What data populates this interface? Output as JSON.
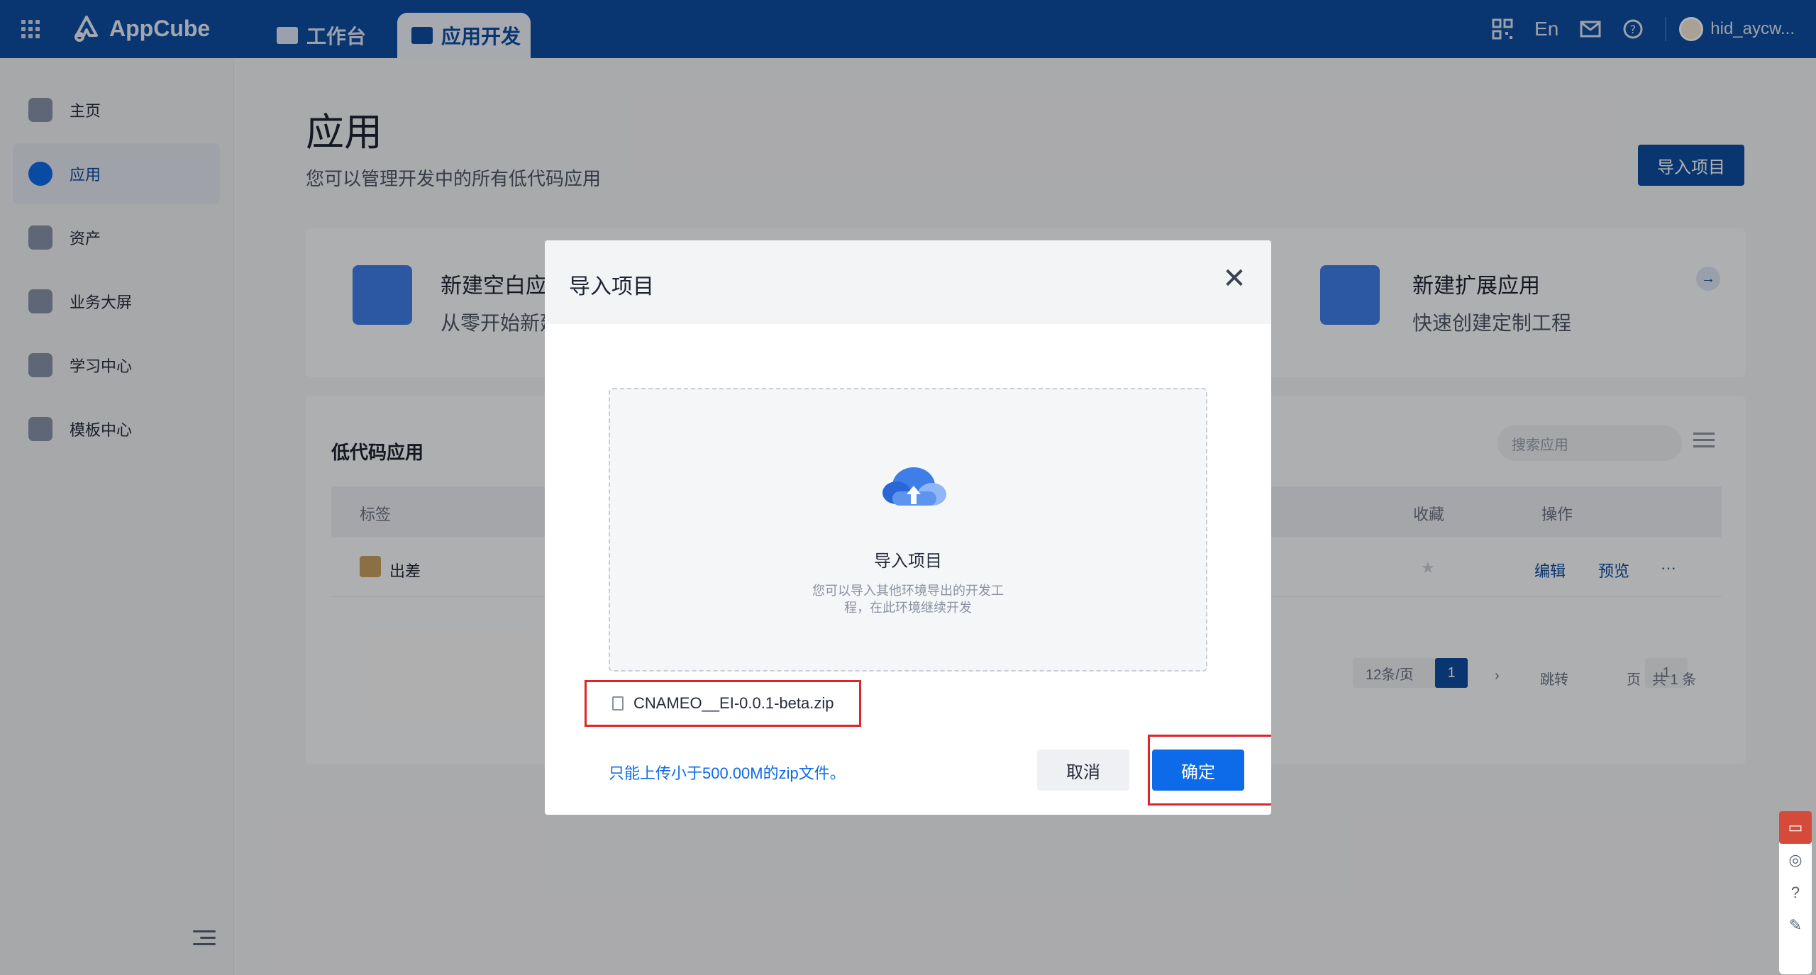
{
  "header": {
    "app_name": "AppCube",
    "tabs": [
      {
        "label": "工作台"
      },
      {
        "label": "应用开发"
      }
    ],
    "lang": "En",
    "username": "hid_aycw..."
  },
  "sidebar": {
    "items": [
      {
        "label": "主页",
        "icon": "code-icon"
      },
      {
        "label": "应用",
        "icon": "app-icon"
      },
      {
        "label": "资产",
        "icon": "database-icon"
      },
      {
        "label": "业务大屏",
        "icon": "chart-icon"
      },
      {
        "label": "学习中心",
        "icon": "learning-icon"
      },
      {
        "label": "模板中心",
        "icon": "layers-icon"
      }
    ]
  },
  "main": {
    "title": "应用",
    "subtitle": "您可以管理开发中的所有低代码应用",
    "import_button": "导入项目",
    "cards": [
      {
        "title": "新建空白应",
        "sub": "从零开始新建"
      },
      {
        "title": "新建扩展应用",
        "sub": "快速创建定制工程"
      }
    ],
    "apps": {
      "title": "低代码应用",
      "search_placeholder": "搜索应用",
      "columns": {
        "tag": "标签",
        "favorite": "收藏",
        "actions": "操作"
      },
      "rows": [
        {
          "name": "出差",
          "edit": "编辑",
          "preview": "预览",
          "more": "···"
        }
      ],
      "pagination": {
        "page_size": "12条/页",
        "current_page": "1",
        "jump_label": "跳转",
        "jump_value": "1",
        "page_unit": "页",
        "total": "共 1 条"
      }
    }
  },
  "dialog": {
    "title": "导入项目",
    "close": "✕",
    "drop_title": "导入项目",
    "drop_desc": "您可以导入其他环境导出的开发工程，在此环境继续开发",
    "file_name": "CNAMEO__EI-0.0.1-beta.zip",
    "hint": "只能上传小于500.00M的zip文件。",
    "cancel": "取消",
    "confirm": "确定"
  },
  "colors": {
    "header_bg": "#0d4da1",
    "primary": "#0d6ae8",
    "highlight_border": "#e0242b"
  }
}
